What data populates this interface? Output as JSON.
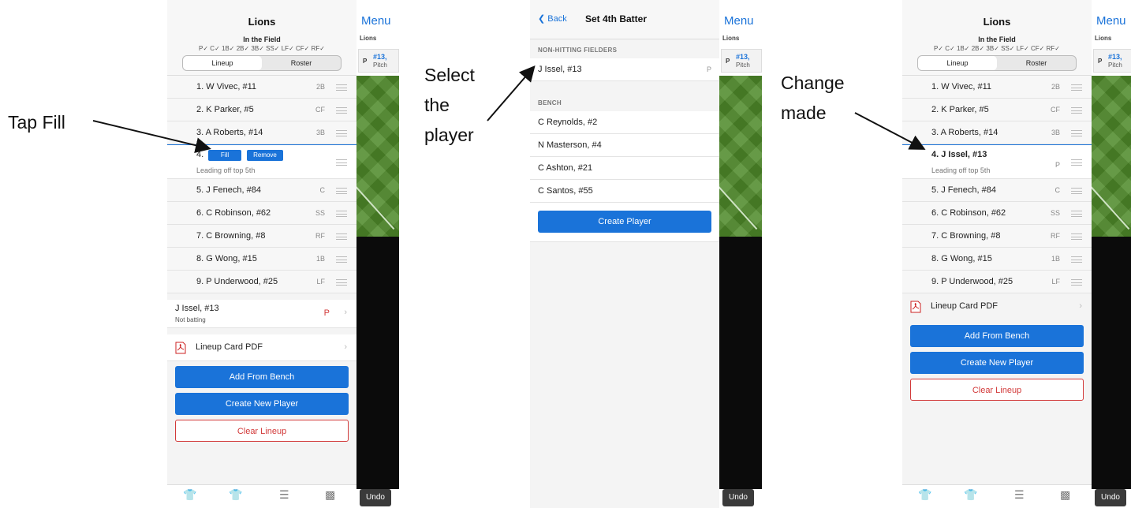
{
  "panel1": {
    "title": "Lions",
    "subtitle": "In the Field",
    "checks": "P✓ C✓ 1B✓ 2B✓ 3B✓ SS✓ LF✓ CF✓ RF✓",
    "seg_lineup": "Lineup",
    "seg_roster": "Roster",
    "rows": [
      {
        "text": "1. W Vivec, #11",
        "pos": "2B"
      },
      {
        "text": "2. K Parker, #5",
        "pos": "CF"
      },
      {
        "text": "3. A Roberts, #14",
        "pos": "3B"
      },
      {
        "text": "4.",
        "sub": "Leading off top 5th"
      },
      {
        "text": "5. J Fenech, #84",
        "pos": "C"
      },
      {
        "text": "6. C Robinson, #62",
        "pos": "SS"
      },
      {
        "text": "7. C Browning, #8",
        "pos": "RF"
      },
      {
        "text": "8. G Wong, #15",
        "pos": "1B"
      },
      {
        "text": "9. P Underwood, #25",
        "pos": "LF"
      }
    ],
    "fill": "Fill",
    "remove": "Remove",
    "notbatting_name": "J Issel, #13",
    "notbatting_label": "Not batting",
    "notbatting_pos": "P",
    "pdf": "Lineup Card PDF",
    "add_bench": "Add From Bench",
    "create_player": "Create New Player",
    "clear": "Clear Lineup"
  },
  "panel2": {
    "back": "Back",
    "title": "Set 4th Batter",
    "sec1": "NON-HITTING FIELDERS",
    "fielder": {
      "text": "J Issel, #13",
      "pos": "P"
    },
    "sec2": "BENCH",
    "bench": [
      "C Reynolds, #2",
      "N Masterson, #4",
      "C Ashton, #21",
      "C Santos, #55"
    ],
    "create": "Create Player"
  },
  "panel3": {
    "title": "Lions",
    "subtitle": "In the Field",
    "checks": "P✓ C✓ 1B✓ 2B✓ 3B✓ SS✓ LF✓ CF✓ RF✓",
    "seg_lineup": "Lineup",
    "seg_roster": "Roster",
    "rows": [
      {
        "text": "1. W Vivec, #11",
        "pos": "2B"
      },
      {
        "text": "2. K Parker, #5",
        "pos": "CF"
      },
      {
        "text": "3. A Roberts, #14",
        "pos": "3B"
      },
      {
        "text": "4. J Issel, #13",
        "pos": "P",
        "sub": "Leading off top 5th"
      },
      {
        "text": "5. J Fenech, #84",
        "pos": "C"
      },
      {
        "text": "6. C Robinson, #62",
        "pos": "SS"
      },
      {
        "text": "7. C Browning, #8",
        "pos": "RF"
      },
      {
        "text": "8. G Wong, #15",
        "pos": "1B"
      },
      {
        "text": "9. P Underwood, #25",
        "pos": "LF"
      }
    ],
    "pdf": "Lineup Card PDF",
    "add_bench": "Add From Bench",
    "create_player": "Create New Player",
    "clear": "Clear Lineup"
  },
  "side": {
    "menu": "Menu",
    "team": "Lions",
    "card_pos": "P",
    "card_name": "#13,",
    "card_sub": "Pitch",
    "undo": "Undo"
  },
  "callouts": {
    "tap_fill": "Tap Fill",
    "select": [
      "Select",
      "the",
      "player"
    ],
    "change": [
      "Change",
      "made"
    ]
  },
  "colors": {
    "accent": "#1a73d9",
    "danger": "#d23a3a",
    "field": "#4f8a2a"
  }
}
